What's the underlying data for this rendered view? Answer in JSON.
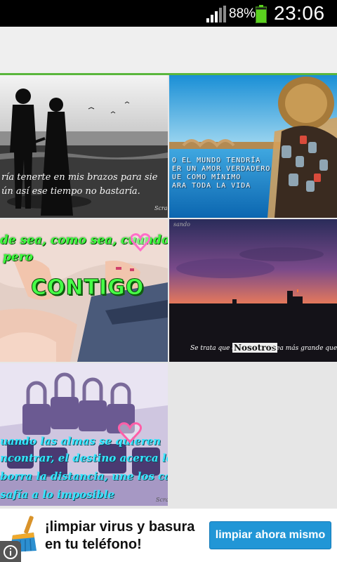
{
  "status_bar": {
    "battery_percent": "88%",
    "battery_level": 0.88,
    "time": "23:06",
    "icons": [
      "signal-icon",
      "battery-icon"
    ]
  },
  "colors": {
    "accent": "#5ab63d",
    "ad_button": "#2196d6",
    "status_bar": "#000000",
    "battery": "#5ad11e"
  },
  "gallery": {
    "tiles": [
      {
        "caption_lines": [
          "ría tenerte en mis brazos para sie",
          "ún así ese tiempo no bastaría."
        ],
        "signature": "Scra"
      },
      {
        "caption_lines": [
          "O EL MUNDO TENDRÍA",
          "ER UN AMOR VERDADERO",
          "UE   COMO MÍNIMO",
          "ARA TODA LA VIDA"
        ]
      },
      {
        "caption_lines": [
          "de sea, como sea, cuando",
          "pero"
        ],
        "highlight": "CONTIGO"
      },
      {
        "caption_pre": "Se trata que el",
        "caption_highlight": "Nosotros",
        "caption_post": "Sea más grande que el tú y",
        "signature": "sando"
      },
      {
        "caption_lines": [
          "uando las almas se quieren",
          "ncontrar,   el destino acerca los mundo",
          "borra la distancia, une los caminos y",
          "safía a lo imposible"
        ],
        "signature": "Scra"
      }
    ]
  },
  "ad": {
    "headline_line1": "¡limpiar virus y basura",
    "headline_line2": "en tu teléfono!",
    "button_label": "limpiar ahora mismo",
    "icon": "broom-icon",
    "info_icon": "info-icon"
  }
}
